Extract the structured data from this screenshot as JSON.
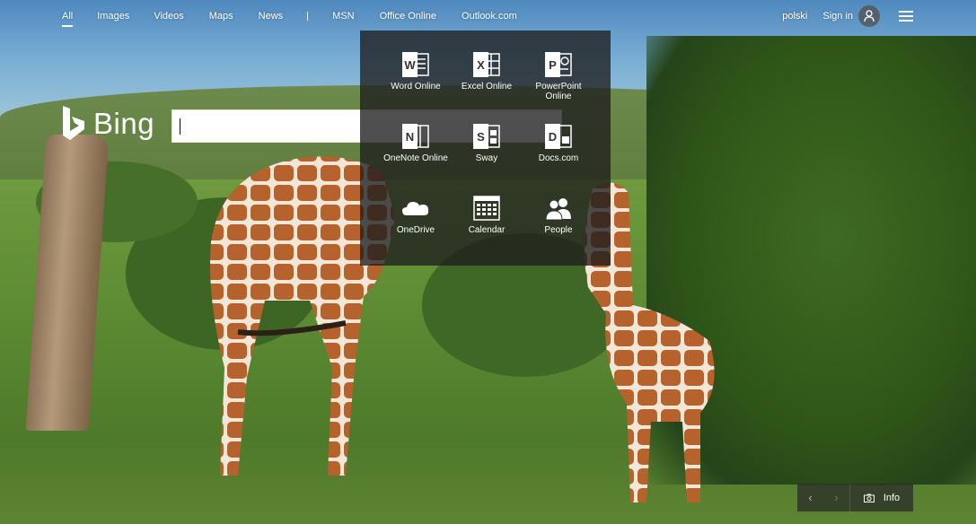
{
  "nav": {
    "items": [
      {
        "label": "All",
        "active": true
      },
      {
        "label": "Images"
      },
      {
        "label": "Videos"
      },
      {
        "label": "Maps"
      },
      {
        "label": "News"
      },
      {
        "label": "MSN"
      },
      {
        "label": "Office Online"
      },
      {
        "label": "Outlook.com"
      }
    ],
    "language": "polski",
    "sign_in": "Sign in",
    "user_icon": "user-icon",
    "menu_icon": "hamburger-menu-icon"
  },
  "logo": {
    "text": "Bing",
    "icon": "bing-logo-icon"
  },
  "search": {
    "value": "",
    "placeholder": ""
  },
  "apps_panel": {
    "apps": [
      {
        "label": "Word Online",
        "icon": "word-icon"
      },
      {
        "label": "Excel Online",
        "icon": "excel-icon"
      },
      {
        "label": "PowerPoint Online",
        "icon": "powerpoint-icon"
      },
      {
        "label": "OneNote Online",
        "icon": "onenote-icon"
      },
      {
        "label": "Sway",
        "icon": "sway-icon"
      },
      {
        "label": "Docs.com",
        "icon": "docs-icon"
      },
      {
        "label": "OneDrive",
        "icon": "onedrive-icon"
      },
      {
        "label": "Calendar",
        "icon": "calendar-icon"
      },
      {
        "label": "People",
        "icon": "people-icon"
      }
    ]
  },
  "bottom_bar": {
    "prev_icon": "‹",
    "next_icon": "›",
    "info_label": "Info",
    "camera_icon": "camera-icon"
  },
  "colors": {
    "panel_bg": "#1e1e1e",
    "text": "#ffffff"
  }
}
